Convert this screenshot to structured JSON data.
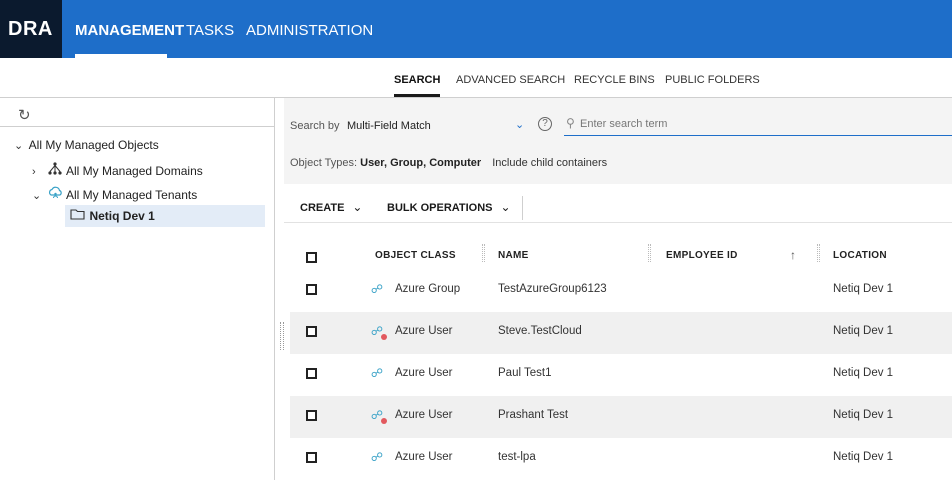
{
  "app": {
    "logo": "DRA",
    "nav_tabs": [
      {
        "label": "MANAGEMENT"
      },
      {
        "label": "TASKS"
      },
      {
        "label": "ADMINISTRATION"
      }
    ]
  },
  "subnav": {
    "tabs": [
      {
        "label": "SEARCH"
      },
      {
        "label": "ADVANCED SEARCH"
      },
      {
        "label": "RECYCLE BINS"
      },
      {
        "label": "PUBLIC FOLDERS"
      }
    ]
  },
  "tree": {
    "refresh_icon": "refresh-icon",
    "root": {
      "label": "All My Managed Objects"
    },
    "domains": {
      "label": "All My Managed Domains"
    },
    "tenants": {
      "label": "All My Managed Tenants"
    },
    "selected": {
      "label": "Netiq Dev 1"
    }
  },
  "search": {
    "by_label": "Search by",
    "by_value": "Multi-Field Match",
    "placeholder": "Enter search term",
    "object_types_label": "Object Types:",
    "object_types_value": "User, Group, Computer",
    "include_child": "Include child containers"
  },
  "toolbar": {
    "create_label": "CREATE",
    "bulk_label": "BULK OPERATIONS"
  },
  "table": {
    "columns": [
      {
        "label": "OBJECT CLASS"
      },
      {
        "label": "NAME"
      },
      {
        "label": "EMPLOYEE ID"
      },
      {
        "label": "LOCATION"
      }
    ],
    "rows": [
      {
        "object_class": "Azure Group",
        "name": "TestAzureGroup6123",
        "employee_id": "",
        "location": "Netiq Dev 1"
      },
      {
        "object_class": "Azure User",
        "name": "Steve.TestCloud",
        "employee_id": "",
        "location": "Netiq Dev 1"
      },
      {
        "object_class": "Azure User",
        "name": "Paul Test1",
        "employee_id": "",
        "location": "Netiq Dev 1"
      },
      {
        "object_class": "Azure User",
        "name": "Prashant Test",
        "employee_id": "",
        "location": "Netiq Dev 1"
      },
      {
        "object_class": "Azure User",
        "name": "test-lpa",
        "employee_id": "",
        "location": "Netiq Dev 1"
      }
    ]
  },
  "colors": {
    "nav_blue": "#1e6ec9",
    "logo_bg": "#0b1a2e",
    "selected_bg": "#e3ecf7",
    "alt_row": "#f0f0f0"
  }
}
